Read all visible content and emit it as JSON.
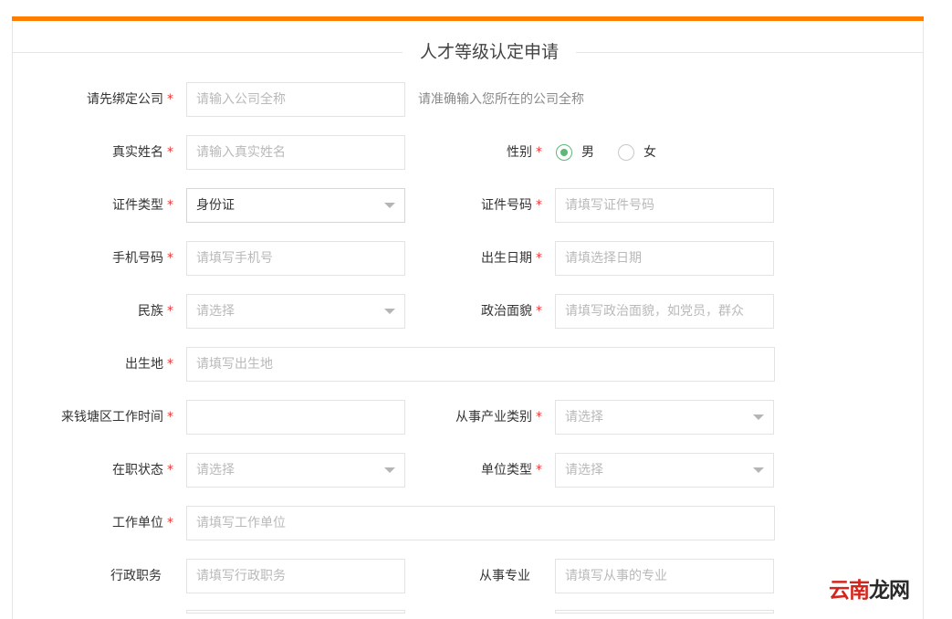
{
  "title": "人才等级认定申请",
  "colors": {
    "accent": "#ff7e00",
    "required": "#e4393c",
    "radio_on": "#5fb878"
  },
  "fields": {
    "company": {
      "label": "请先绑定公司",
      "placeholder": "请输入公司全称",
      "hint": "请准确输入您所在的公司全称"
    },
    "real_name": {
      "label": "真实姓名",
      "placeholder": "请输入真实姓名"
    },
    "gender": {
      "label": "性别",
      "options": [
        "男",
        "女"
      ],
      "selected": "男"
    },
    "id_type": {
      "label": "证件类型",
      "value": "身份证"
    },
    "id_number": {
      "label": "证件号码",
      "placeholder": "请填写证件号码"
    },
    "phone": {
      "label": "手机号码",
      "placeholder": "请填写手机号"
    },
    "birth_date": {
      "label": "出生日期",
      "placeholder": "请填选择日期"
    },
    "ethnicity": {
      "label": "民族",
      "placeholder": "请选择"
    },
    "political": {
      "label": "政治面貌",
      "placeholder": "请填写政治面貌，如党员，群众"
    },
    "birthplace": {
      "label": "出生地",
      "placeholder": "请填写出生地"
    },
    "work_time": {
      "label": "来钱塘区工作时间",
      "placeholder": ""
    },
    "industry": {
      "label": "从事产业类别",
      "placeholder": "请选择"
    },
    "job_status": {
      "label": "在职状态",
      "placeholder": "请选择"
    },
    "unit_type": {
      "label": "单位类型",
      "placeholder": "请选择"
    },
    "employer": {
      "label": "工作单位",
      "placeholder": "请填写工作单位"
    },
    "admin_post": {
      "label": "行政职务",
      "placeholder": "请填写行政职务"
    },
    "specialty": {
      "label": "从事专业",
      "placeholder": "请填写从事的专业"
    }
  },
  "required_mark": "*",
  "watermark": {
    "part1": "云南",
    "part2": "龙网"
  }
}
